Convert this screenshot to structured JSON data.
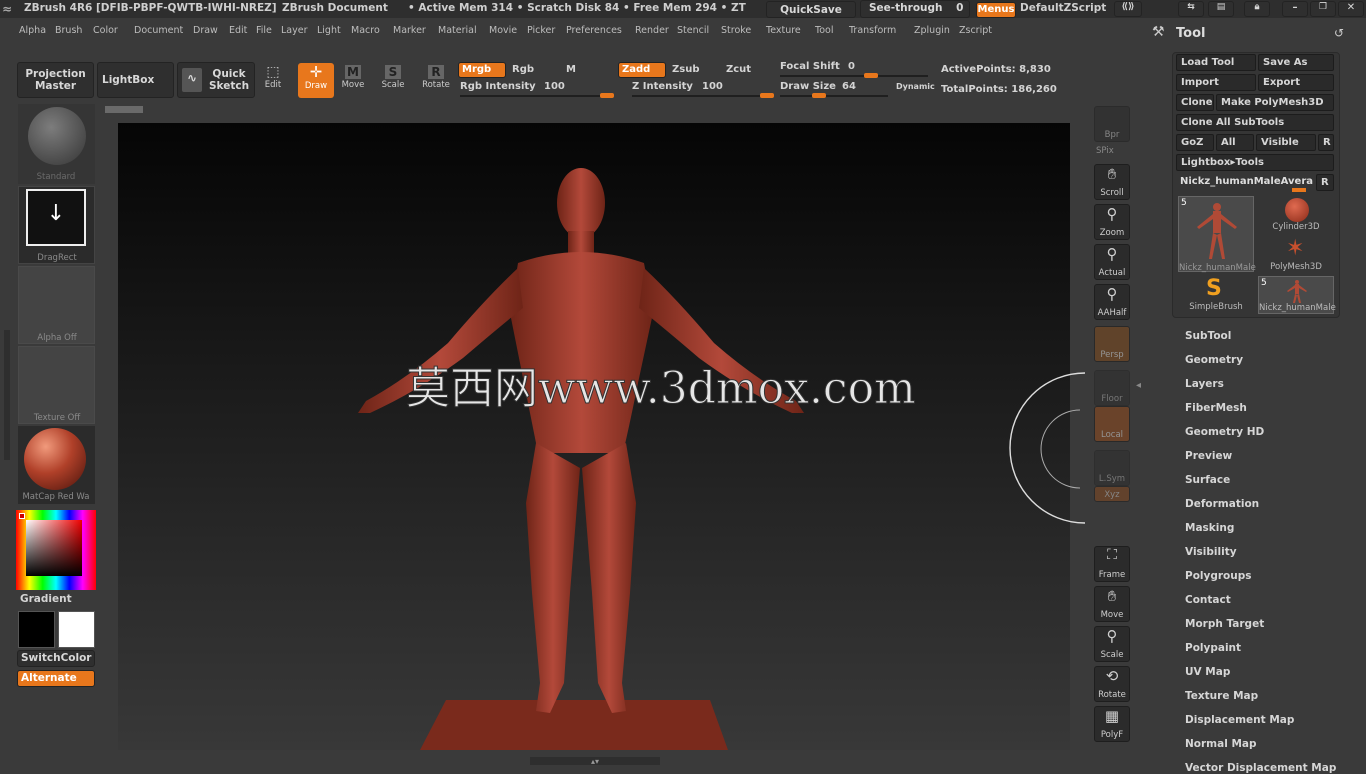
{
  "titlebar": {
    "app": "ZBrush 4R6 [DFIB-PBPF-QWTB-IWHI-NREZ]",
    "doc": "ZBrush Document",
    "stats": "• Active Mem 314 • Scratch Disk 84 • Free Mem 294 • ZT",
    "quicksave": "QuickSave",
    "seethrough_label": "See-through",
    "seethrough_value": "0",
    "menus": "Menus",
    "script": "DefaultZScript"
  },
  "menubar": [
    "Alpha",
    "Brush",
    "Color",
    "Document",
    "Draw",
    "Edit",
    "File",
    "Layer",
    "Light",
    "Macro",
    "Marker",
    "Material",
    "Movie",
    "Picker",
    "Preferences",
    "Render",
    "Stencil",
    "Stroke",
    "Texture",
    "Tool",
    "Transform",
    "Zplugin",
    "Zscript"
  ],
  "topshelf": {
    "projection_master": "Projection Master",
    "lightbox": "LightBox",
    "quick_sketch": "Quick Sketch",
    "edit": "Edit",
    "draw": "Draw",
    "move": "Move",
    "scale": "Scale",
    "rotate": "Rotate",
    "mrgb": "Mrgb",
    "rgb": "Rgb",
    "m": "M",
    "zadd": "Zadd",
    "zsub": "Zsub",
    "zcut": "Zcut",
    "rgb_intensity_label": "Rgb Intensity",
    "rgb_intensity_value": "100",
    "z_intensity_label": "Z Intensity",
    "z_intensity_value": "100",
    "focal_shift_label": "Focal Shift",
    "focal_shift_value": "0",
    "draw_size_label": "Draw Size",
    "draw_size_value": "64",
    "dynamic": "Dynamic",
    "active_points_label": "ActivePoints:",
    "active_points_value": "8,830",
    "total_points_label": "TotalPoints:",
    "total_points_value": "186,260"
  },
  "leftbar": {
    "brush": "Standard",
    "stroke": "DragRect",
    "alpha": "Alpha  Off",
    "texture": "Texture  Off",
    "material": "MatCap  Red  Wa",
    "gradient": "Gradient",
    "switchcolor": "SwitchColor",
    "alternate": "Alternate"
  },
  "rightshelf": [
    "Bpr",
    "SPix",
    "Scroll",
    "Zoom",
    "Actual",
    "AAHalf",
    "Persp",
    "Floor",
    "Local",
    "L.Sym",
    "Xyz",
    "Frame",
    "Move",
    "Scale",
    "Rotate",
    "PolyF"
  ],
  "toolpanel": {
    "title": "Tool",
    "load_tool": "Load Tool",
    "save_as": "Save As",
    "import": "Import",
    "export": "Export",
    "clone": "Clone",
    "make_polymesh": "Make PolyMesh3D",
    "clone_all": "Clone  All  SubTools",
    "goz": "GoZ",
    "all": "All",
    "visible": "Visible",
    "r": "R",
    "lightbox_tools": "Lightbox▸Tools",
    "current_tool": "Nickz_humanMaleAvera",
    "thumbs": [
      {
        "label": "Nickz_humanMale",
        "count": "5"
      },
      {
        "label": "Cylinder3D"
      },
      {
        "label": "PolyMesh3D"
      },
      {
        "label": "SimpleBrush"
      },
      {
        "label": "Nickz_humanMale",
        "count": "5"
      }
    ],
    "sections": [
      "SubTool",
      "Geometry",
      "Layers",
      "FiberMesh",
      "Geometry HD",
      "Preview",
      "Surface",
      "Deformation",
      "Masking",
      "Visibility",
      "Polygroups",
      "Contact",
      "Morph Target",
      "Polypaint",
      "UV Map",
      "Texture Map",
      "Displacement Map",
      "Normal Map",
      "Vector Displacement Map"
    ]
  },
  "watermark": "莫西网www.3dmox.com",
  "colors": {
    "accent": "#e8771c",
    "model": "#a8402c"
  }
}
